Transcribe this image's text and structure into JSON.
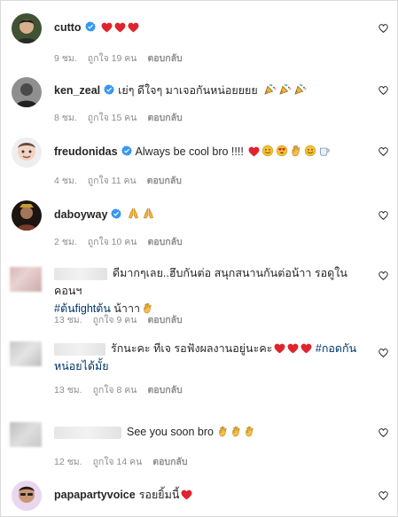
{
  "comments": [
    {
      "username": "cutto",
      "text": "",
      "time": "9 ชม.",
      "likes": "ถูกใจ 19 คน",
      "reply": "ตอบกลับ"
    },
    {
      "username": "ken_zeal",
      "text": "เย่ๆ ดีใจๆ มาเจอกันหน่อยยยย",
      "time": "8 ชม.",
      "likes": "ถูกใจ 15 คน",
      "reply": "ตอบกลับ"
    },
    {
      "username": "freudonidas",
      "text": "Always be cool bro !!!!",
      "time": "4 ชม.",
      "likes": "ถูกใจ 11 คน",
      "reply": "ตอบกลับ"
    },
    {
      "username": "daboyway",
      "text": "",
      "time": "2 ชม.",
      "likes": "ถูกใจ 10 คน",
      "reply": "ตอบกลับ"
    },
    {
      "username": "",
      "text_line1": "ดีมากๆเลย..ฮึบกันต่อ สนุกสนานกันต่อน้าา รอดูในคอนฯ",
      "hashtag": "#ต้นfightต้น",
      "text_line2": " น้าาา",
      "time": "13 ชม.",
      "likes": "ถูกใจ 9 คน",
      "reply": "ตอบกลับ"
    },
    {
      "username": "",
      "text_line1": "รักนะคะ ทีเจ รอฟังผลงานอยู่นะคะ",
      "hashtag": "#กอดกัน",
      "text_line2": "หน่อยได้มั้ย",
      "time": "13 ชม.",
      "likes": "ถูกใจ 8 คน",
      "reply": "ตอบกลับ"
    },
    {
      "username": "",
      "text": "See you soon bro",
      "time": "12 ชม.",
      "likes": "ถูกใจ 14 คน",
      "reply": "ตอบกลับ"
    },
    {
      "username": "papapartyvoice",
      "text": "รอยยิ้มนี้"
    }
  ],
  "colors": {
    "verified": "#3897f0",
    "heart_red": "#e0242f",
    "meta": "#8e8e8e",
    "hashtag": "#00376b"
  }
}
